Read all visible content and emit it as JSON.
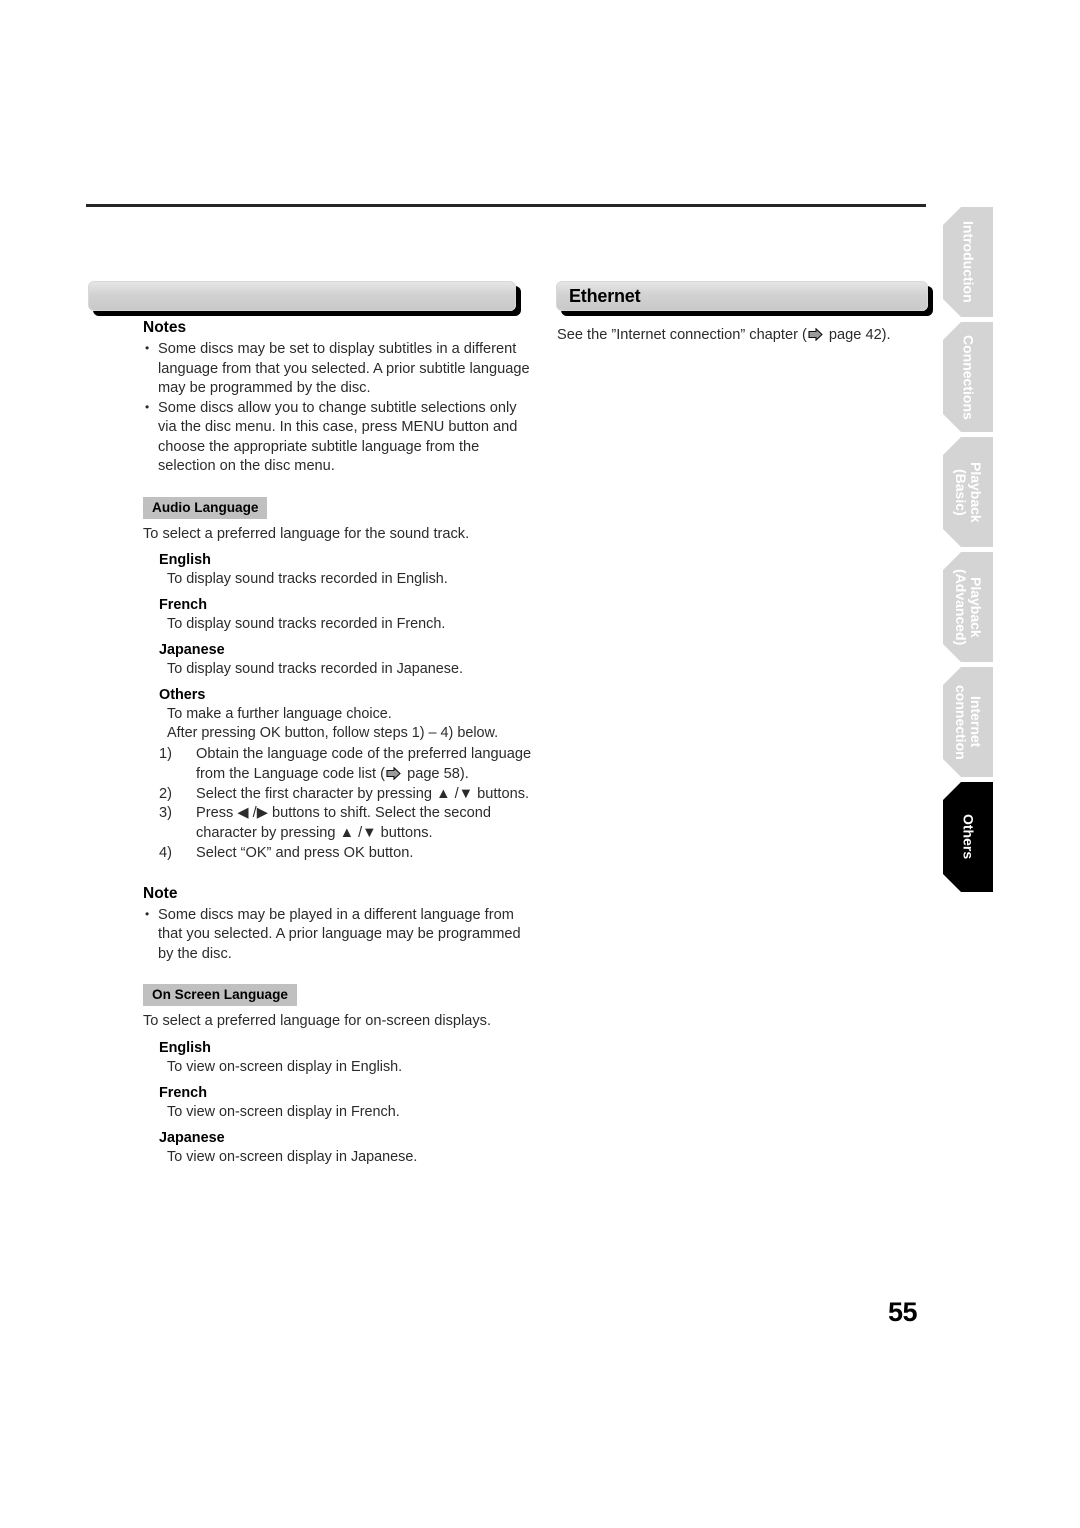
{
  "document": {
    "page_number": "55"
  },
  "header_bars": {
    "left": {
      "title": ""
    },
    "right": {
      "title": "Ethernet"
    }
  },
  "left_column": {
    "notes_heading": "Notes",
    "notes_bullets": [
      "Some discs may be set to display subtitles in a different language from that you selected. A prior subtitle language may be programmed by the disc.",
      "Some discs allow you to change subtitle selections only via the disc menu. In this case, press MENU button and choose the appropriate subtitle language from the selection on the disc menu."
    ],
    "audio_language": {
      "chip_label": "Audio Language",
      "lead": "To select a preferred language for the sound track.",
      "options": [
        {
          "name": "English",
          "desc": "To display sound tracks recorded in English."
        },
        {
          "name": "French",
          "desc": "To display sound tracks recorded in French."
        },
        {
          "name": "Japanese",
          "desc": "To display sound tracks recorded in Japanese."
        },
        {
          "name": "Others",
          "desc": "To make a further language choice."
        }
      ],
      "others_intro": "After pressing OK button, follow steps 1) – 4) below.",
      "steps": [
        {
          "num": "1)",
          "text_before": "Obtain the language code of the preferred language from the Language code list (",
          "text_after": " page 58)."
        },
        {
          "num": "2)",
          "text_before": "Select the first character by pressing ▲ /▼ buttons.",
          "text_after": ""
        },
        {
          "num": "3)",
          "text_before": "Press ◀ /▶ buttons to shift. Select the second character by pressing ▲ /▼ buttons.",
          "text_after": ""
        },
        {
          "num": "4)",
          "text_before": "Select “OK” and press OK button.",
          "text_after": ""
        }
      ]
    },
    "note": {
      "heading": "Note",
      "bullets": [
        "Some discs may be played in a different language from that you selected. A prior language may be programmed by the disc."
      ]
    },
    "on_screen_language": {
      "chip_label": "On Screen Language",
      "lead": "To select a preferred language for on-screen displays.",
      "options": [
        {
          "name": "English",
          "desc": "To view on-screen display in English."
        },
        {
          "name": "French",
          "desc": "To view on-screen display in French."
        },
        {
          "name": "Japanese",
          "desc": "To view on-screen display in Japanese."
        }
      ]
    }
  },
  "right_column": {
    "reference_before": "See the ”Internet connection” chapter (",
    "reference_after": " page 42)."
  },
  "side_tabs": [
    {
      "label": "Introduction",
      "active": false
    },
    {
      "label": "Connections",
      "active": false
    },
    {
      "label": "Playback\n(Basic)",
      "active": false
    },
    {
      "label": "Playback\n(Advanced)",
      "active": false
    },
    {
      "label": "Internet\nconnection",
      "active": false
    },
    {
      "label": "Others",
      "active": true
    }
  ],
  "colors": {
    "tab_inactive_bg": "#d4d4d4",
    "tab_active_bg": "#000000",
    "chip_bg": "#c0c0c0",
    "bar_bg": "#d2d2d2",
    "arrow_fill": "#9a9a9a"
  }
}
